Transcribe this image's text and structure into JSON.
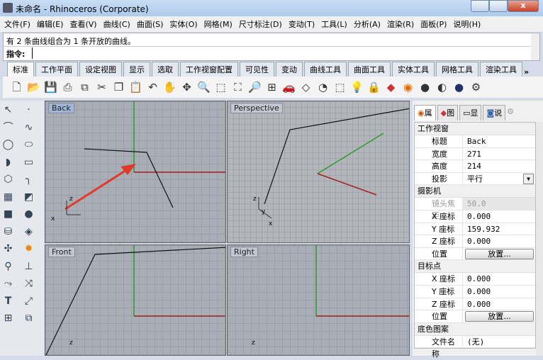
{
  "window": {
    "title": "未命名 - Rhinoceros (Corporate)"
  },
  "menu": [
    "文件(F)",
    "编辑(E)",
    "查看(V)",
    "曲线(C)",
    "曲面(S)",
    "实体(O)",
    "网格(M)",
    "尺寸标注(D)",
    "变动(T)",
    "工具(L)",
    "分析(A)",
    "渲染(R)",
    "面板(P)",
    "说明(H)"
  ],
  "command": {
    "history": "有 2 条曲线组合为 1 条开放的曲线。",
    "prompt": "指令:"
  },
  "tabs": [
    "标准",
    "工作平面",
    "设定视图",
    "显示",
    "选取",
    "工作视窗配置",
    "可见性",
    "变动",
    "曲线工具",
    "曲面工具",
    "实体工具",
    "网格工具",
    "渲染工具"
  ],
  "tabs_more": "»",
  "viewports": {
    "back": "Back",
    "perspective": "Perspective",
    "front": "Front",
    "right": "Right"
  },
  "panel": {
    "tabs": [
      "属",
      "图",
      "显",
      "说"
    ],
    "sections": {
      "viewport": "工作视窗",
      "camera": "摄影机",
      "target": "目标点",
      "wallpaper": "底色图案"
    },
    "viewport_rows": [
      {
        "k": "标题",
        "v": "Back"
      },
      {
        "k": "宽度",
        "v": "271"
      },
      {
        "k": "高度",
        "v": "214"
      },
      {
        "k": "投影",
        "v": "平行"
      }
    ],
    "camera_rows": [
      {
        "k": "镜头焦距",
        "v": "50.0"
      },
      {
        "k": "X 座标",
        "v": "0.000"
      },
      {
        "k": "Y 座标",
        "v": "159.932"
      },
      {
        "k": "Z 座标",
        "v": "0.000"
      },
      {
        "k": "位置",
        "v": "放置..."
      }
    ],
    "target_rows": [
      {
        "k": "X 座标",
        "v": "0.000"
      },
      {
        "k": "Y 座标",
        "v": "0.000"
      },
      {
        "k": "Z 座标",
        "v": "0.000"
      },
      {
        "k": "位置",
        "v": "放置..."
      }
    ],
    "wallpaper_rows": [
      {
        "k": "文件名称",
        "v": "(无)"
      }
    ]
  }
}
